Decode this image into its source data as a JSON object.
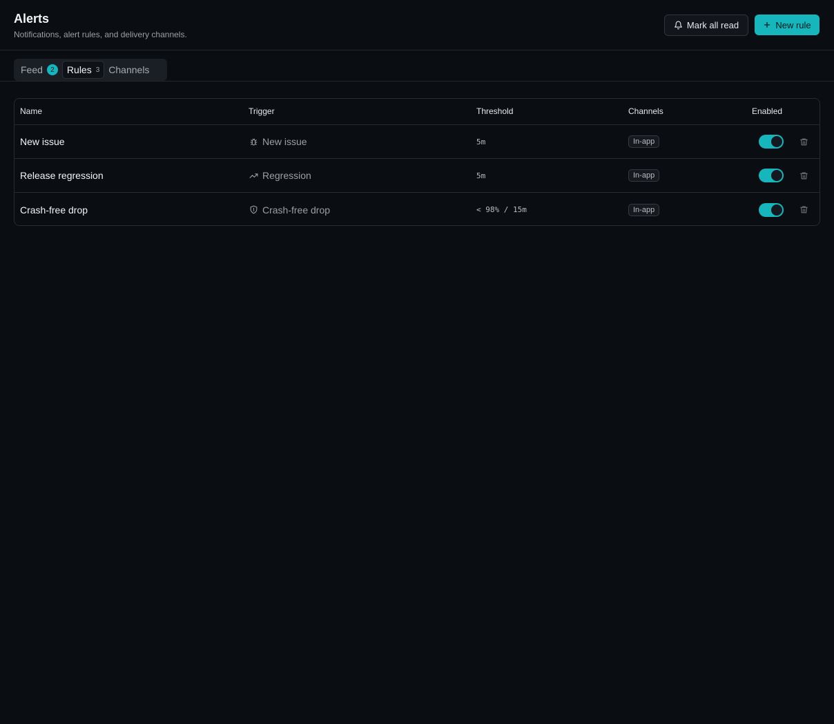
{
  "header": {
    "title": "Alerts",
    "subtitle": "Notifications, alert rules, and delivery channels.",
    "mark_all_read_label": "Mark all read",
    "new_rule_label": "New rule"
  },
  "tabs": [
    {
      "label": "Feed",
      "badge": "2"
    },
    {
      "label": "Rules",
      "count": "3"
    },
    {
      "label": "Channels"
    }
  ],
  "table": {
    "columns": [
      "Name",
      "Trigger",
      "Threshold",
      "Channels",
      "Enabled"
    ],
    "rows": [
      {
        "name": "New issue",
        "trigger": "New issue",
        "trigger_icon": "bug-icon",
        "threshold": "5m",
        "channel": "In-app",
        "enabled": true
      },
      {
        "name": "Release regression",
        "trigger": "Regression",
        "trigger_icon": "trending-up-icon",
        "threshold": "5m",
        "channel": "In-app",
        "enabled": true
      },
      {
        "name": "Crash-free drop",
        "trigger": "Crash-free drop",
        "trigger_icon": "shield-icon",
        "threshold": "< 98% / 15m",
        "channel": "In-app",
        "enabled": true
      }
    ]
  },
  "colors": {
    "accent": "#17b6bd",
    "background": "#0a0d12",
    "border": "#262a31"
  }
}
